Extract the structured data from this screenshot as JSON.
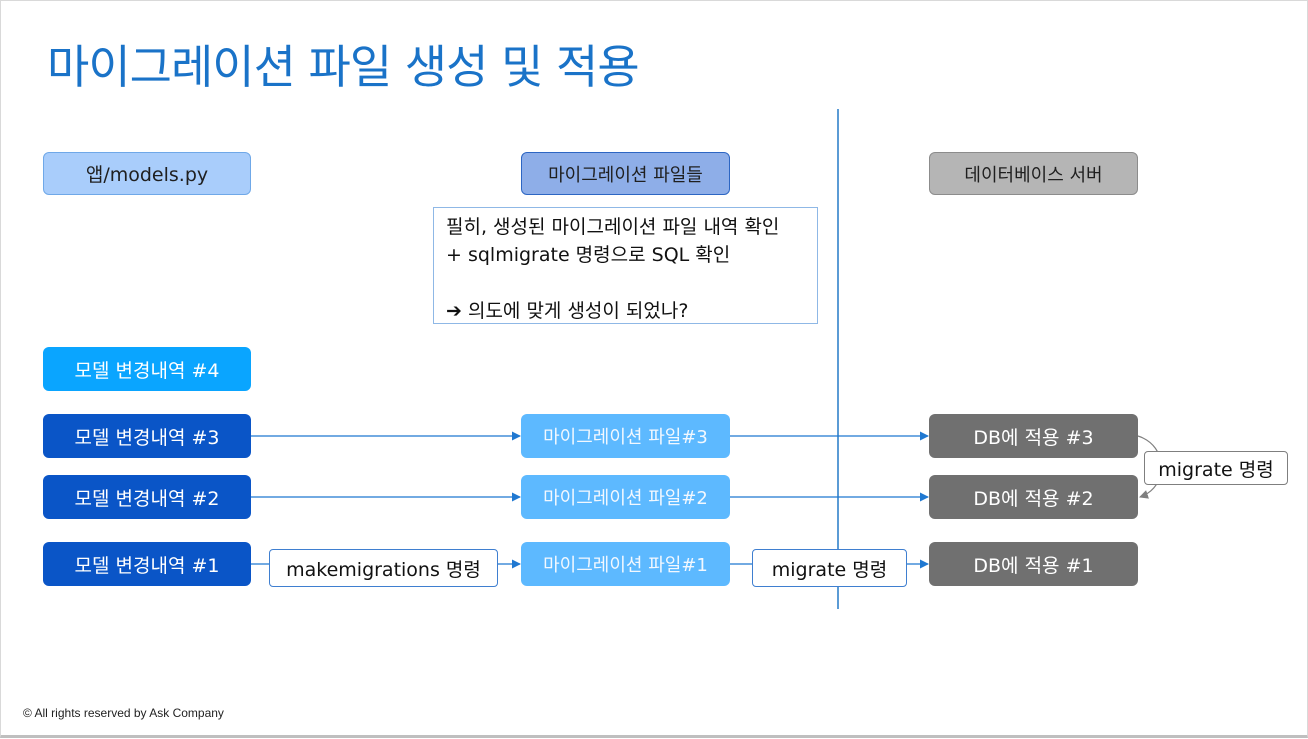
{
  "title": "마이그레이션 파일 생성 및 적용",
  "headers": {
    "models": "앱/models.py",
    "migrations": "마이그레이션 파일들",
    "db": "데이터베이스 서버"
  },
  "note": {
    "line1": "필히, 생성된 마이그레이션 파일 내역 확인",
    "line2": "+ sqlmigrate 명령으로 SQL 확인",
    "arrow": "➔",
    "line3": "의도에 맞게 생성이 되었나?"
  },
  "models": {
    "change4": "모델 변경내역 #4",
    "change3": "모델 변경내역 #3",
    "change2": "모델 변경내역 #2",
    "change1": "모델 변경내역 #1"
  },
  "migration_files": {
    "file3": "마이그레이션 파일#3",
    "file2": "마이그레이션 파일#2",
    "file1": "마이그레이션 파일#1"
  },
  "db_apply": {
    "apply3": "DB에 적용 #3",
    "apply2": "DB에 적용 #2",
    "apply1": "DB에 적용 #1"
  },
  "commands": {
    "makemigrations": "makemigrations 명령",
    "migrate_row1": "migrate 명령",
    "migrate_side": "migrate 명령"
  },
  "footer": "© All rights reserved by Ask Company",
  "colors": {
    "title": "#1a73c8",
    "model_dark": "#0a55c7",
    "model_light": "#0aa5ff",
    "migration_file": "#5db9ff",
    "db_box": "#707070",
    "arrow": "#1f78d1"
  }
}
